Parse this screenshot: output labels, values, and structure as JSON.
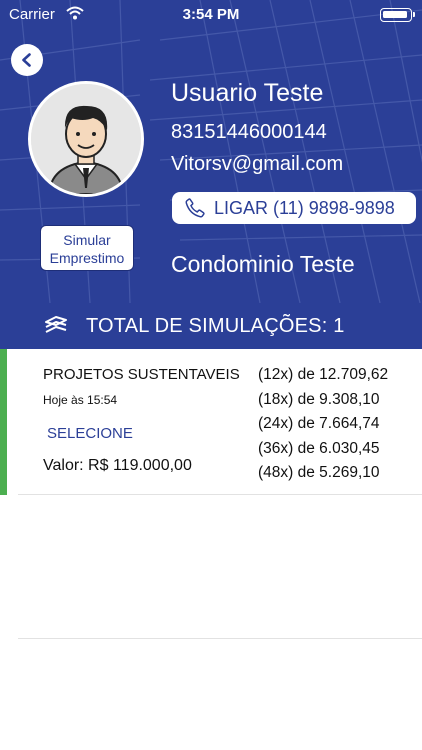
{
  "status_bar": {
    "carrier": "Carrier",
    "time": "3:54 PM"
  },
  "profile": {
    "name": "Usuario Teste",
    "document": "83151446000144",
    "email": "Vitorsv@gmail.com",
    "call_label": "LIGAR (11) 9898-9898",
    "simulate_label": [
      "Simular",
      "Emprestimo"
    ],
    "condominium": "Condominio Teste"
  },
  "summary": {
    "total_label": "TOTAL DE SIMULAÇÕES: 1"
  },
  "simulations": [
    {
      "project": "PROJETOS SUSTENTAVEIS",
      "date": "Hoje às 15:54",
      "select_label": "SELECIONE",
      "value": "Valor: R$ 119.000,00",
      "installments": [
        "(12x) de 12.709,62",
        "(18x) de 9.308,10",
        "(24x) de 7.664,74",
        "(36x) de 6.030,45",
        "(48x) de 5.269,10"
      ]
    }
  ],
  "colors": {
    "primary": "#2b3f97",
    "accent": "#4caf50",
    "divider": "#e2e2e2"
  },
  "icons": [
    "back-arrow-icon",
    "phone-icon",
    "stack-icon",
    "wifi-icon",
    "battery-icon"
  ]
}
